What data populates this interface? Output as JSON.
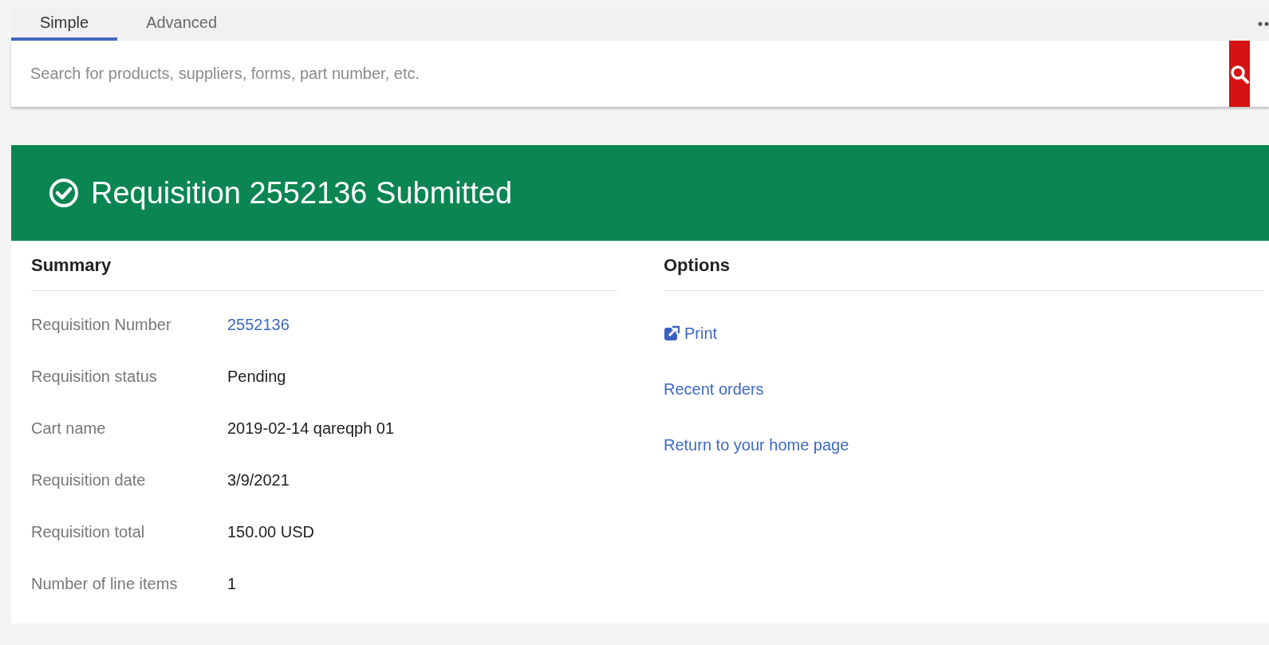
{
  "tabs": [
    {
      "label": "Simple",
      "selected": true
    },
    {
      "label": "Advanced",
      "selected": false
    }
  ],
  "search": {
    "placeholder": "Search for products, suppliers, forms, part number, etc."
  },
  "banner": {
    "title": "Requisition 2552136 Submitted"
  },
  "summary": {
    "heading": "Summary",
    "rows": [
      {
        "label": "Requisition Number",
        "value": "2552136",
        "kind": "link"
      },
      {
        "label": "Requisition status",
        "value": "Pending",
        "kind": "text"
      },
      {
        "label": "Cart name",
        "value": "2019-02-14 qareqph 01",
        "kind": "text"
      },
      {
        "label": "Requisition date",
        "value": "3/9/2021",
        "kind": "text"
      },
      {
        "label": "Requisition total",
        "value": "150.00 USD",
        "kind": "text"
      },
      {
        "label": "Number of line items",
        "value": "1",
        "kind": "text"
      }
    ]
  },
  "options": {
    "heading": "Options",
    "items": [
      {
        "label": "Print",
        "kind": "icon-link"
      },
      {
        "label": "Recent orders",
        "kind": "link"
      },
      {
        "label": "Return to your home page",
        "kind": "link"
      }
    ]
  }
}
